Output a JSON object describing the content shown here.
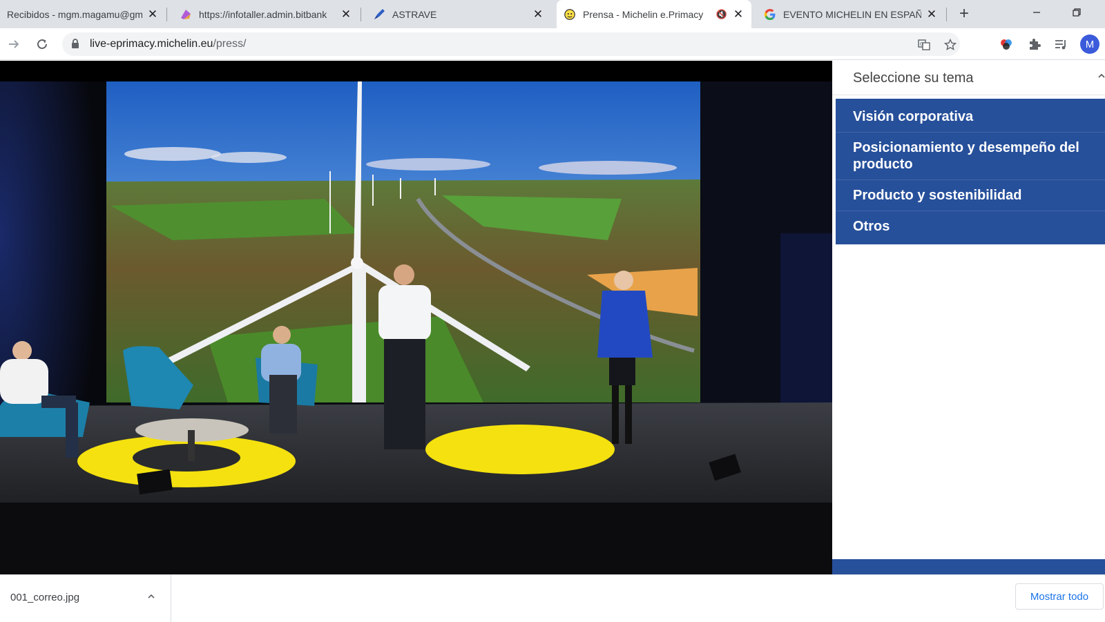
{
  "tabs": [
    {
      "title": "Recibidos - mgm.magamu@gm",
      "icon": "gmail-icon",
      "active": false
    },
    {
      "title": "https://infotaller.admin.bitbank",
      "icon": "bitbank-icon",
      "active": false
    },
    {
      "title": "ASTRAVE",
      "icon": "rocket-icon",
      "active": false
    },
    {
      "title": "Prensa - Michelin e.Primacy",
      "icon": "michelin-bibendum-icon",
      "active": true
    },
    {
      "title": "EVENTO MICHELIN EN ESPAÑOL",
      "icon": "google-icon",
      "active": false
    }
  ],
  "address": {
    "domain": "live-eprimacy.michelin.eu",
    "path": "/press/"
  },
  "panel": {
    "header": "Seleccione su tema",
    "topics": [
      "Visión corporativa",
      "Posicionamiento y desempeño del producto",
      "Producto y sostenibilidad",
      "Otros"
    ]
  },
  "user": {
    "initial": "M"
  },
  "download": {
    "filename": "001_correo.jpg",
    "show_all": "Mostrar todo"
  },
  "colors": {
    "panel_blue": "#27509b",
    "spot_yellow": "#f4e10f"
  }
}
